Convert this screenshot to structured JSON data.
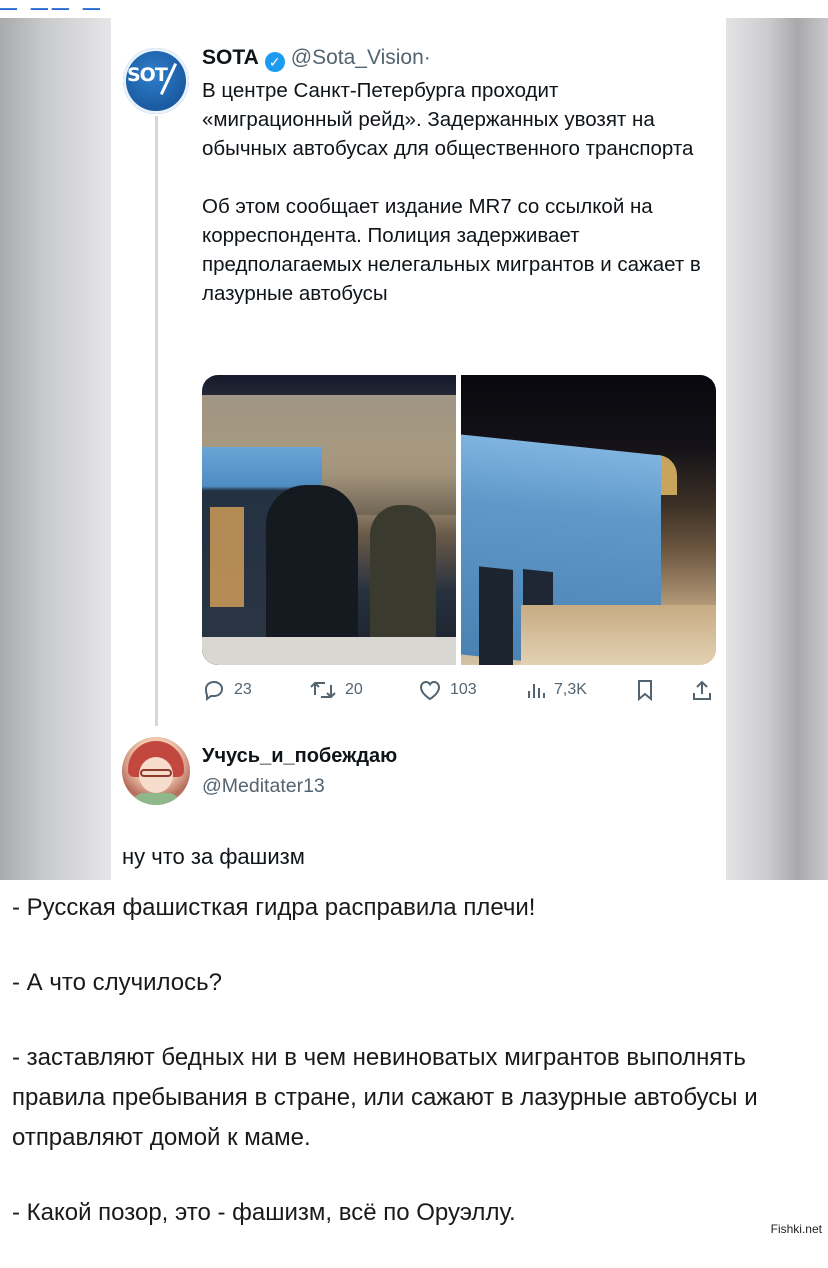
{
  "post": {
    "author_name": "SOTA",
    "verified_mark": "✓",
    "handle": "@Sota_Vision",
    "separator": "·",
    "paragraph1": "В центре Санкт-Петербурга проходит «миграционный рейд». Задержанных увозят на обычных автобусах для общественного транспорта",
    "paragraph2": "Об этом сообщает издание MR7 со ссылкой на корреспондента. Полиция задерживает предполагаемых нелегальных мигрантов и сажает в лазурные автобусы",
    "stats": {
      "replies": "23",
      "reposts": "20",
      "likes": "103",
      "views": "7,3K"
    },
    "icons": [
      "reply-icon",
      "repost-icon",
      "like-icon",
      "views-icon",
      "bookmark-icon",
      "share-icon"
    ]
  },
  "reply": {
    "author_name": "Учусь_и_побеждаю",
    "handle": "@Meditater13",
    "text": "ну что за фашизм"
  },
  "article": {
    "lines": [
      "- Русская фашисткая гидра расправила плечи!",
      "- А что случилось?",
      "- заставляют бедных ни в чем невиноватых мигрантов выполнять правила пребывания в стране, или сажают в лазурные автобусы и отправляют домой к маме.",
      "- Какой позор, это - фашизм, всё по Оруэллу."
    ]
  },
  "watermark": "Fishki.net",
  "colors": {
    "verified": "#1d9bf0",
    "secondary_text": "#536471",
    "thread_line": "#cfd9de"
  }
}
